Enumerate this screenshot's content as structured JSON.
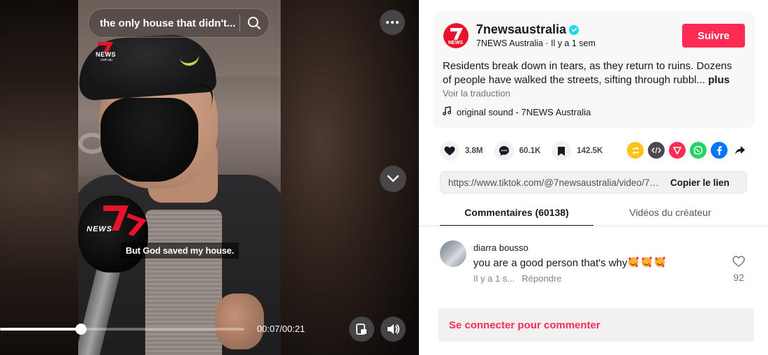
{
  "video": {
    "search_text": "the only house that didn't...",
    "caption": "But God saved my house.",
    "station_logo_text": "NEWS",
    "station_logo_sub": ".com.au",
    "mic_logo_text": "NEWS",
    "time": "00:07/00:21",
    "progress": 0.33
  },
  "post": {
    "username": "7newsaustralia",
    "display_name": "7NEWS Australia",
    "time_ago": "Il y a 1 sem",
    "follow_label": "Suivre",
    "description_line1": "Residents break down in tears, as they return to ruins. Dozens",
    "description_line2": "of people have walked the streets, sifting through rubbl...",
    "more_label": "plus",
    "translate_label": "Voir la traduction",
    "sound": "original sound - 7NEWS Australia",
    "avatar_text": "NEWS"
  },
  "actions": {
    "likes": "3.8M",
    "comments": "60.1K",
    "saves": "142.5K"
  },
  "share_icons": [
    {
      "name": "repost-icon",
      "color": "#ffc21a"
    },
    {
      "name": "embed-icon",
      "color": "#4a4a4f"
    },
    {
      "name": "send-icon",
      "color": "#fe2c55"
    },
    {
      "name": "whatsapp-icon",
      "color": "#25d366"
    },
    {
      "name": "facebook-icon",
      "color": "#0075fa"
    },
    {
      "name": "share-arrow-icon",
      "color": "#161823"
    }
  ],
  "link": {
    "url": "https://www.tiktok.com/@7newsaustralia/video/74...",
    "copy_label": "Copier le lien"
  },
  "tabs": {
    "comments": "Commentaires (60138)",
    "creator_videos": "Vidéos du créateur"
  },
  "comment": {
    "user": "diarra bousso",
    "text": "you are a good person that's why",
    "time": "Il y a 1 s...",
    "reply_label": "Répondre",
    "likes": "92"
  },
  "login_label": "Se connecter pour commenter",
  "colors": {
    "accent": "#fe2c55",
    "verified": "#20d5ec"
  }
}
